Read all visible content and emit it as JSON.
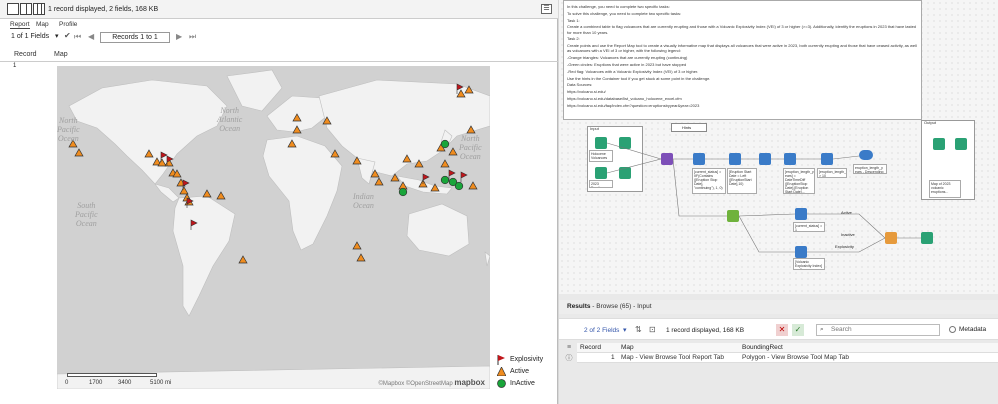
{
  "left": {
    "status": "1 record displayed, 2 fields, 168 KB",
    "tabs": [
      "Report",
      "Map",
      "Profile"
    ],
    "fields_label": "1 of 1 Fields",
    "records_label": "Records 1 to 1",
    "col_record": "Record",
    "col_map": "Map",
    "row_number": "1",
    "oceans": {
      "north_atlantic": "North\nAtlantic\nOcean",
      "north_pacific": "North\nPacific\nOcean",
      "south_pacific": "South\nPacific\nOcean",
      "indian": "Indian\nOcean",
      "north_pacific_right": "North\nPacific\nOcean"
    },
    "scale": {
      "s0": "0",
      "s1": "1700",
      "s2": "3400",
      "s3": "5100 mi"
    },
    "credit": "©Mapbox ©OpenStreetMap",
    "mapbox_logo": "mapbox",
    "legend": [
      {
        "label": "Explosivity",
        "symbol": "red-flag",
        "color": "#c0161b"
      },
      {
        "label": "Active",
        "symbol": "orange-triangle",
        "color": "#f08c1e"
      },
      {
        "label": "InActive",
        "symbol": "green-circle",
        "color": "#19a53a"
      }
    ]
  },
  "comment": [
    "In this challenge, you need to complete two specific tasks:",
    "To solve this challenge, you need to complete two specific tasks:",
    "Task 1:",
    "Create a combined table to flag volcanoes that are currently erupting and those with a Volcanic Explosivity Index (VEI) of 3 or higher (>=3). Additionally, identify the eruptions in 2023 that have lasted for more than 10 years.",
    "Task 2:",
    "Create points and use the Report Map tool to create a visually informative map that displays all volcanoes that were active in 2023, both currently erupting and those that have ceased activity, as well as volcanoes with a VEI of 3 or higher, with the following legend:",
    "-Orange triangles: Volcanoes that are currently erupting (continuing)",
    "-Green circles: Eruptions that were active in 2023 but have stopped",
    "-Red flag: Volcanoes with a Volcanic Explosivity Index (VEI) of 3 or higher.",
    "Use the hints in the Container tool if you get stuck at some point in the challenge.",
    "Data Sources:",
    "https://volcano.si.edu/",
    "https://volcano.si.edu/database/list_volcano_holocene_excel.cfm",
    "https://volcano.si.edu/faq/index.cfm?question=eruptionsbyyear&year=2023"
  ],
  "workflow": {
    "input_title": "Input",
    "output_title": "Output",
    "hints": "Hints",
    "in1": "Holocene Volcanoes",
    "in2": "2023 Eruptions",
    "f1": "[current_status] = IIF(Contains ([Eruption Stop Date], \"continuing\"), 1, 0)",
    "f2": "[Eruption Start Date = Left ([EruptionStart Date],10)",
    "f3": "[eruption_length_y ears] = DateTimeDiff ([EruptionStop Date],[Eruption Start Date]...",
    "f4": "[eruption_length_years] > 10",
    "f5": "eruption_length_y ears - Descending",
    "f6": "[current_status] = 1",
    "f7": "[Volcanic Explosivity Index] >= 3",
    "out1": "Map of 2023 volcanic eruptions...",
    "active": "Active",
    "inactive": "Inactive",
    "explosivity": "Explosivity"
  },
  "results": {
    "title": "Results",
    "path": "- Browse (65) - Input",
    "fields": "2 of 2 Fields",
    "msg": "1 record displayed, 168 KB",
    "search": "Search",
    "metadata": "Metadata",
    "headers": [
      "Record",
      "Map",
      "BoundingRect"
    ],
    "rows": [
      [
        "1",
        "Map - View Browse Tool Report Tab",
        "Polygon - View Browse Tool Map Tab"
      ]
    ]
  }
}
